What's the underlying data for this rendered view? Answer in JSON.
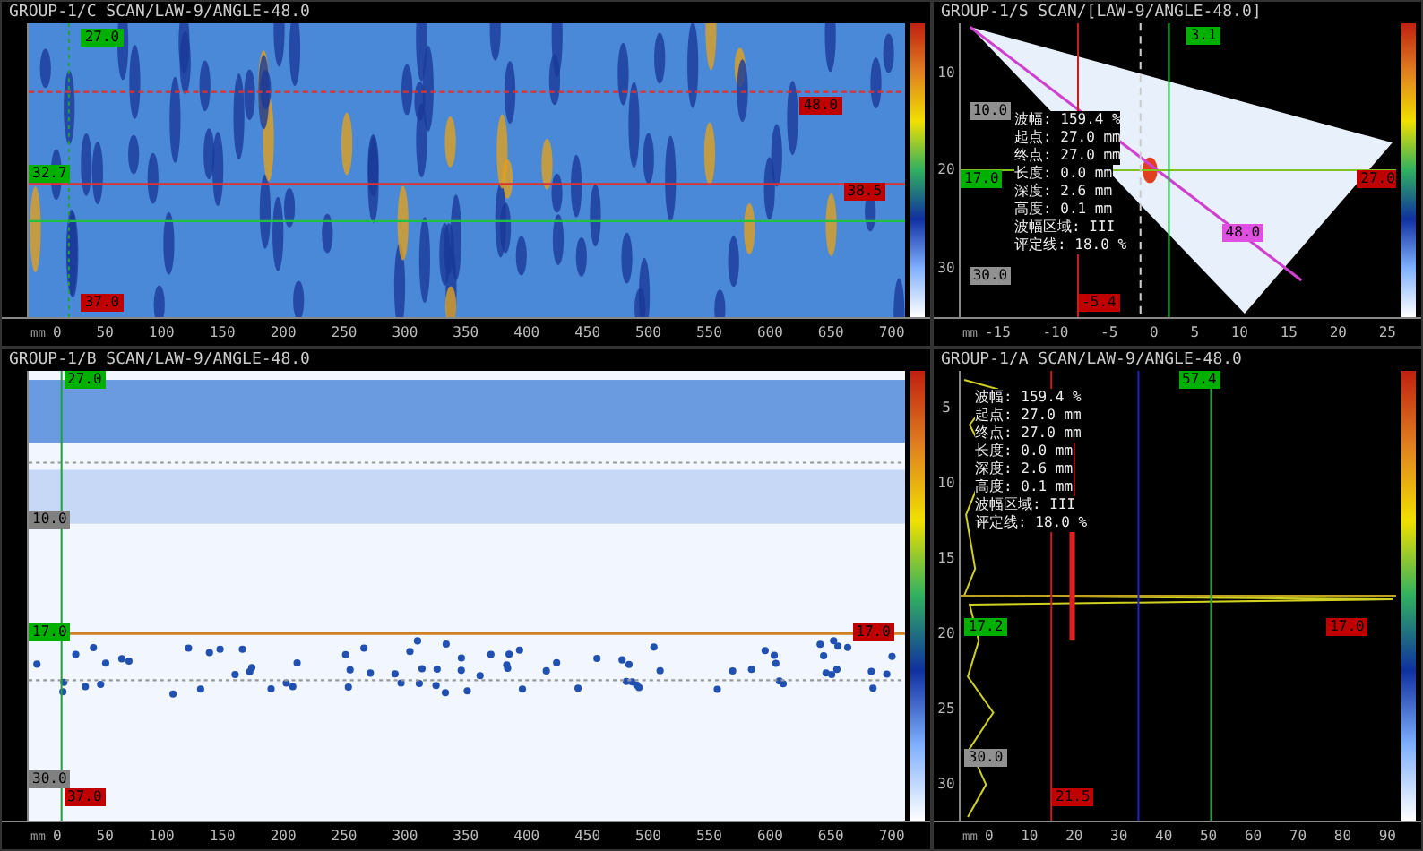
{
  "panels": [
    {
      "kind": "cscan",
      "title": "GROUP-1/C SCAN/LAW-9/ANGLE-48.0",
      "xticks": [
        "0",
        "50",
        "100",
        "150",
        "200",
        "250",
        "300",
        "350",
        "400",
        "450",
        "500",
        "550",
        "600",
        "650",
        "700"
      ],
      "xunit": "mm",
      "markers": [
        {
          "text": "27.0",
          "color": "#00b000"
        },
        {
          "text": "32.7",
          "color": "#00b000"
        },
        {
          "text": "37.0",
          "color": "#c00000"
        },
        {
          "text": "48.0",
          "color": "#c00000"
        },
        {
          "text": "38.5",
          "color": "#c00000"
        }
      ]
    },
    {
      "kind": "sscan",
      "title": "GROUP-1/S SCAN/[LAW-9/ANGLE-48.0]",
      "xticks": [
        "-15",
        "-10",
        "-5",
        "0",
        "5",
        "10",
        "15",
        "20",
        "25"
      ],
      "xunit": "mm",
      "yticks": [
        "10",
        "20",
        "30"
      ],
      "markers": [
        {
          "text": "3.1",
          "color": "#00b000"
        },
        {
          "text": "10.0",
          "color": "#909090"
        },
        {
          "text": "17.0",
          "color": "#00b000"
        },
        {
          "text": "27.0",
          "color": "#c00000"
        },
        {
          "text": "48.0",
          "color": "#e050e0"
        },
        {
          "text": "30.0",
          "color": "#909090"
        },
        {
          "text": "-5.4",
          "color": "#c00000"
        }
      ],
      "readouts": [
        "波幅: 159.4 %",
        "起点: 27.0 mm",
        "终点: 27.0 mm",
        "长度: 0.0 mm",
        "深度: 2.6 mm",
        "高度: 0.1 mm",
        "波幅区域: III",
        "评定线: 18.0 %"
      ]
    },
    {
      "kind": "bscan",
      "title": "GROUP-1/B SCAN/LAW-9/ANGLE-48.0",
      "xticks": [
        "0",
        "50",
        "100",
        "150",
        "200",
        "250",
        "300",
        "350",
        "400",
        "450",
        "500",
        "550",
        "600",
        "650",
        "700"
      ],
      "xunit": "mm",
      "markers": [
        {
          "text": "27.0",
          "color": "#00b000"
        },
        {
          "text": "10.0",
          "color": "#808080"
        },
        {
          "text": "17.0",
          "color": "#00b000"
        },
        {
          "text": "17.0",
          "color": "#c00000"
        },
        {
          "text": "30.0",
          "color": "#808080"
        },
        {
          "text": "37.0",
          "color": "#c00000"
        }
      ]
    },
    {
      "kind": "ascan",
      "title": "GROUP-1/A SCAN/LAW-9/ANGLE-48.0",
      "xticks": [
        "0",
        "10",
        "20",
        "30",
        "40",
        "50",
        "60",
        "70",
        "80",
        "90"
      ],
      "xunit": "mm",
      "yticks": [
        "5",
        "10",
        "15",
        "20",
        "25",
        "30"
      ],
      "markers": [
        {
          "text": "57.4",
          "color": "#00b000"
        },
        {
          "text": "17.2",
          "color": "#00b000"
        },
        {
          "text": "17.0",
          "color": "#c00000"
        },
        {
          "text": "30.0",
          "color": "#909090"
        },
        {
          "text": "21.5",
          "color": "#c00000"
        }
      ],
      "readouts": [
        "波幅: 159.4 %",
        "起点: 27.0 mm",
        "终点: 27.0 mm",
        "长度: 0.0 mm",
        "深度: 2.6 mm",
        "高度: 0.1 mm",
        "波幅区域: III",
        "评定线: 18.0 %"
      ]
    }
  ]
}
